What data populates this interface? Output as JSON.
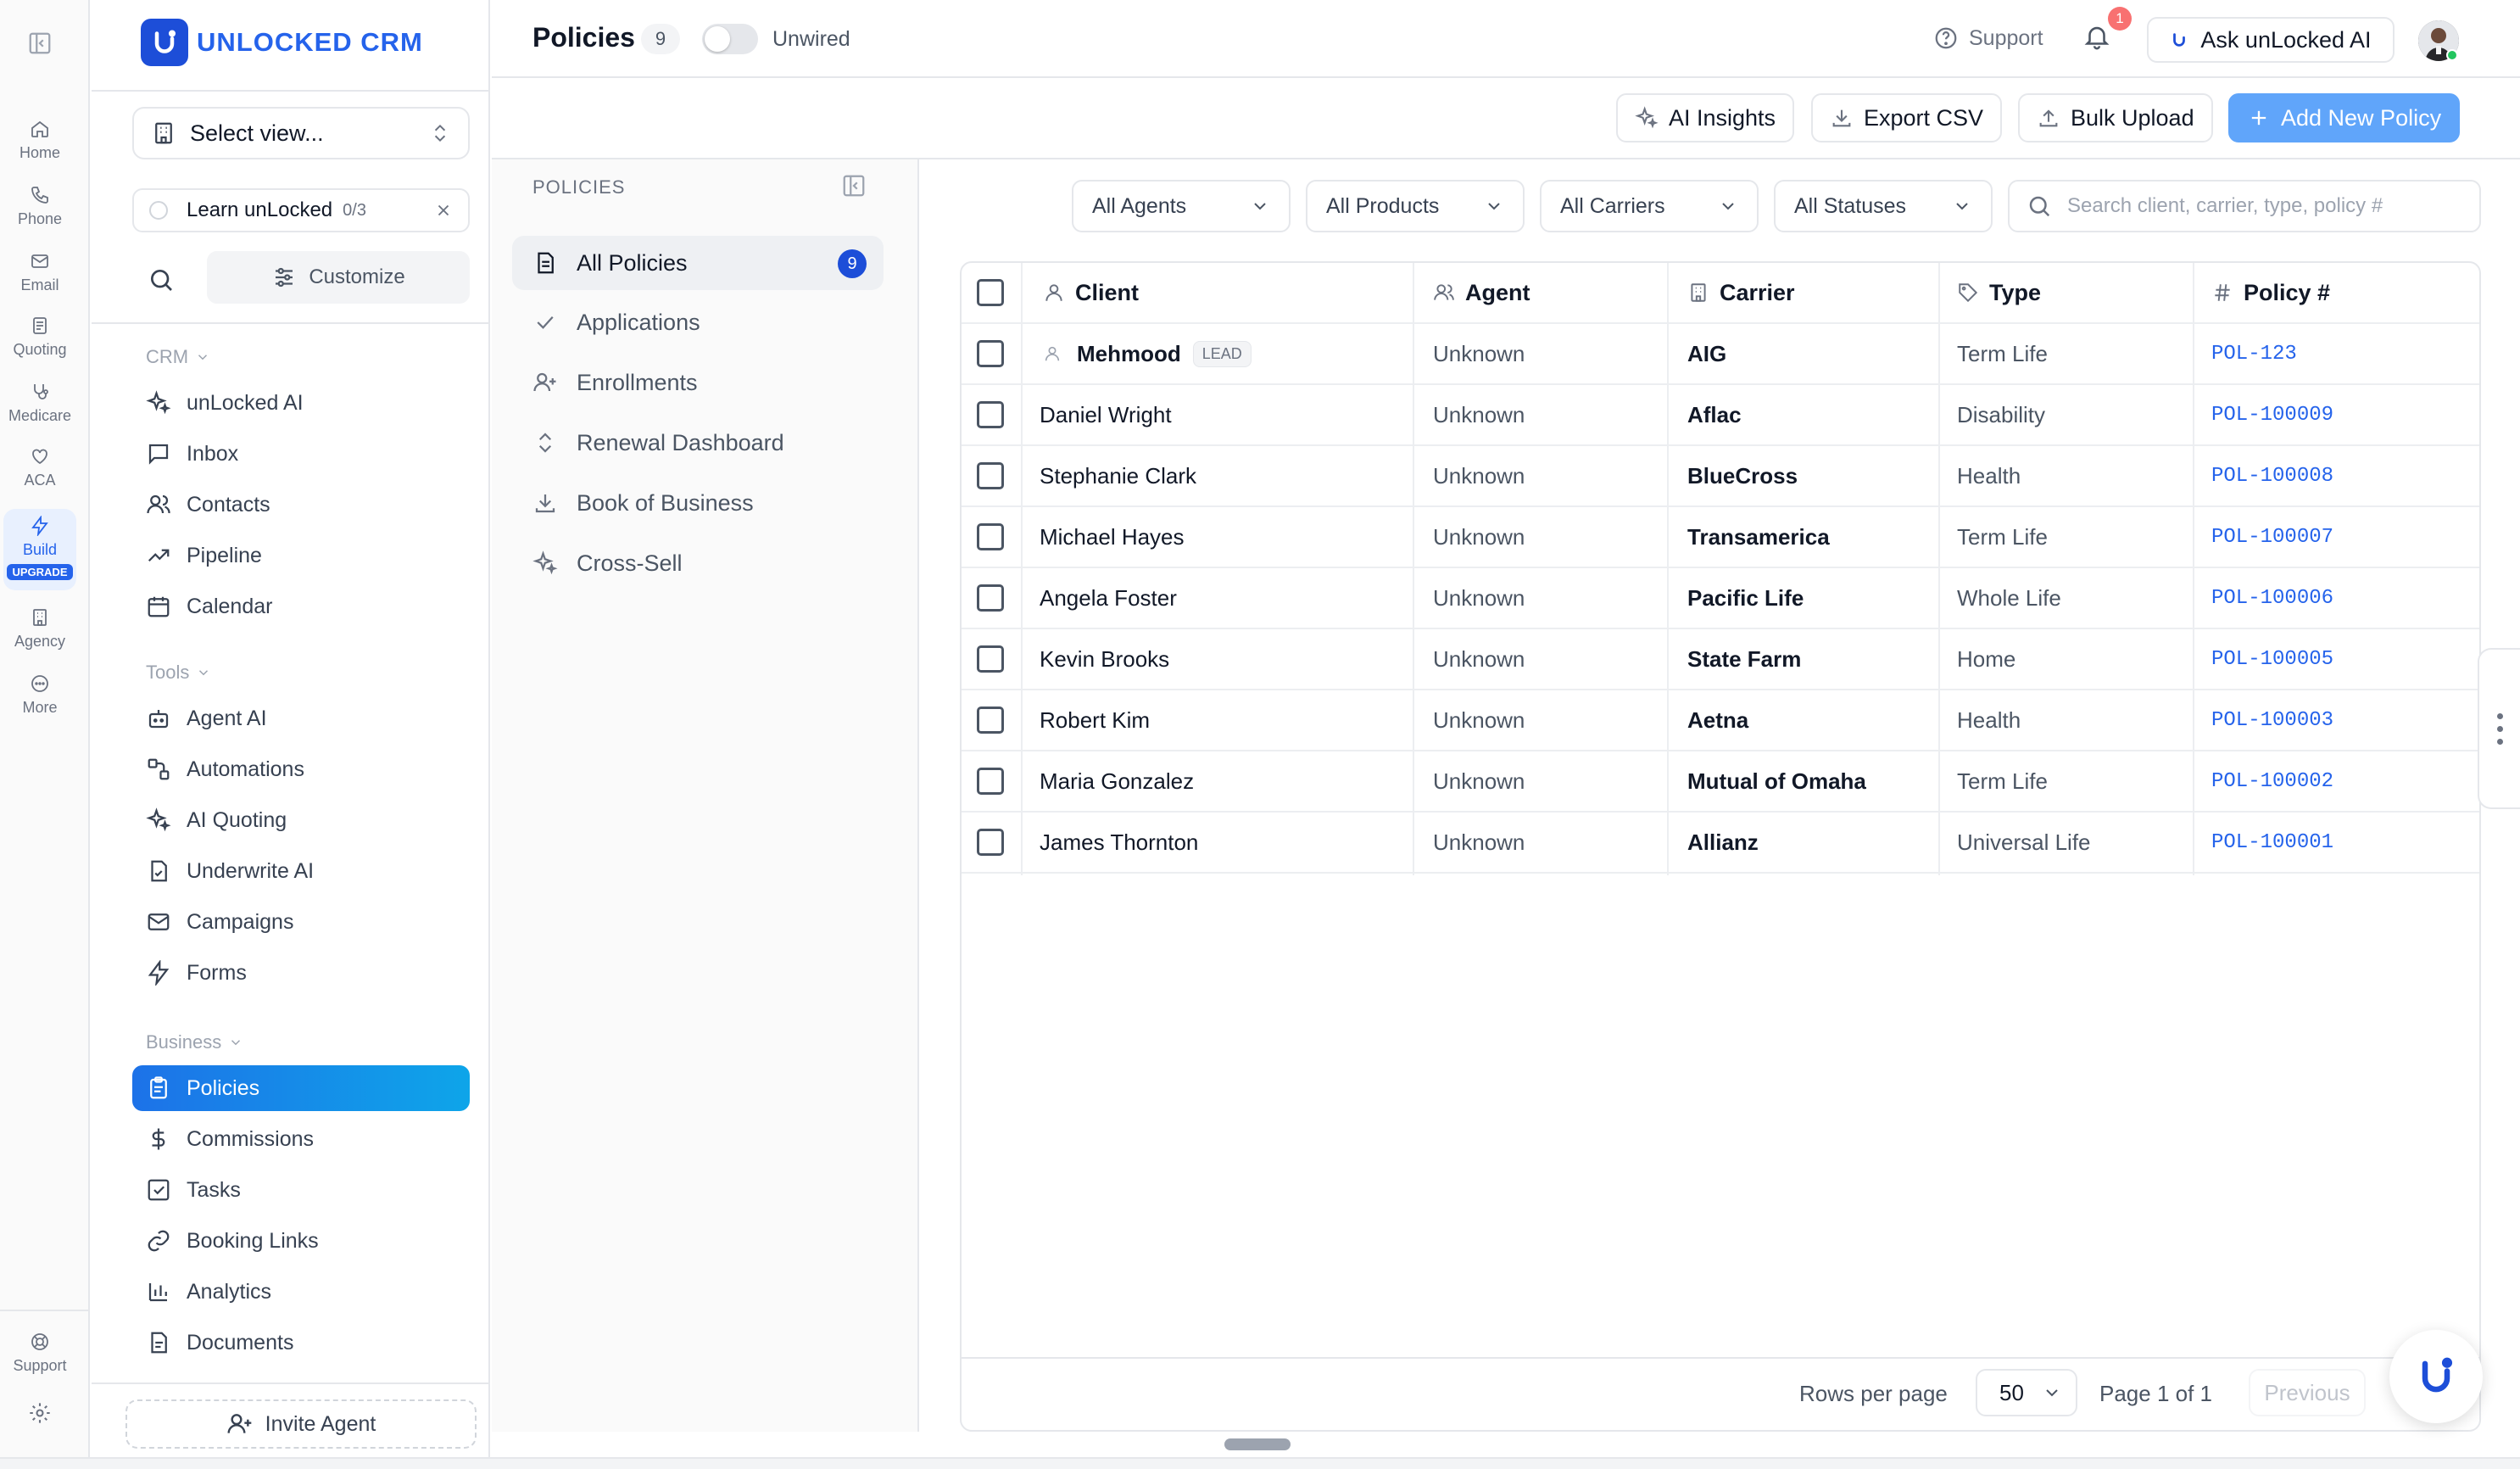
{
  "rail": {
    "items": [
      {
        "label": "Home",
        "icon": "home-icon"
      },
      {
        "label": "Phone",
        "icon": "phone-icon"
      },
      {
        "label": "Email",
        "icon": "mail-icon"
      },
      {
        "label": "Quoting",
        "icon": "document-icon"
      },
      {
        "label": "Medicare",
        "icon": "stethoscope-icon"
      },
      {
        "label": "ACA",
        "icon": "heart-icon"
      },
      {
        "label": "Build",
        "icon": "lightning-icon",
        "badge": "UPGRADE"
      },
      {
        "label": "Agency",
        "icon": "building-icon"
      },
      {
        "label": "More",
        "icon": "more-icon"
      }
    ],
    "support_label": "Support"
  },
  "sidebar": {
    "brand": "UNLOCKED CRM",
    "view_select": "Select view...",
    "learn": {
      "label": "Learn unLocked",
      "progress": "0/3"
    },
    "customize": "Customize",
    "sections": {
      "crm": "CRM",
      "tools": "Tools",
      "business": "Business"
    },
    "crm_items": [
      "unLocked AI",
      "Inbox",
      "Contacts",
      "Pipeline",
      "Calendar"
    ],
    "tools_items": [
      "Agent AI",
      "Automations",
      "AI Quoting",
      "Underwrite AI",
      "Campaigns",
      "Forms"
    ],
    "business_items": [
      "Policies",
      "Commissions",
      "Tasks",
      "Booking Links",
      "Analytics",
      "Documents"
    ],
    "invite": "Invite Agent"
  },
  "topbar": {
    "title": "Policies",
    "count": "9",
    "toggle_label": "Unwired",
    "support": "Support",
    "notifications": "1",
    "ask": "Ask unLocked AI"
  },
  "actions": {
    "ai_insights": "AI Insights",
    "export_csv": "Export CSV",
    "bulk_upload": "Bulk Upload",
    "add_new": "Add New Policy"
  },
  "subpanel": {
    "title": "POLICIES",
    "items": [
      {
        "label": "All Policies",
        "badge": "9"
      },
      {
        "label": "Applications"
      },
      {
        "label": "Enrollments"
      },
      {
        "label": "Renewal Dashboard"
      },
      {
        "label": "Book of Business"
      },
      {
        "label": "Cross-Sell"
      }
    ]
  },
  "filters": {
    "agents": "All Agents",
    "products": "All Products",
    "carriers": "All Carriers",
    "statuses": "All Statuses",
    "search_placeholder": "Search client, carrier, type, policy #"
  },
  "table": {
    "headers": {
      "client": "Client",
      "agent": "Agent",
      "carrier": "Carrier",
      "type": "Type",
      "policy": "Policy #"
    },
    "rows": [
      {
        "client": "Mehmood",
        "badge": "LEAD",
        "agent": "Unknown",
        "carrier": "AIG",
        "type": "Term Life",
        "policy": "POL-123"
      },
      {
        "client": "Daniel Wright",
        "agent": "Unknown",
        "carrier": "Aflac",
        "type": "Disability",
        "policy": "POL-100009"
      },
      {
        "client": "Stephanie Clark",
        "agent": "Unknown",
        "carrier": "BlueCross",
        "type": "Health",
        "policy": "POL-100008"
      },
      {
        "client": "Michael Hayes",
        "agent": "Unknown",
        "carrier": "Transamerica",
        "type": "Term Life",
        "policy": "POL-100007"
      },
      {
        "client": "Angela Foster",
        "agent": "Unknown",
        "carrier": "Pacific Life",
        "type": "Whole Life",
        "policy": "POL-100006"
      },
      {
        "client": "Kevin Brooks",
        "agent": "Unknown",
        "carrier": "State Farm",
        "type": "Home",
        "policy": "POL-100005"
      },
      {
        "client": "Robert Kim",
        "agent": "Unknown",
        "carrier": "Aetna",
        "type": "Health",
        "policy": "POL-100003"
      },
      {
        "client": "Maria Gonzalez",
        "agent": "Unknown",
        "carrier": "Mutual of Omaha",
        "type": "Term Life",
        "policy": "POL-100002"
      },
      {
        "client": "James Thornton",
        "agent": "Unknown",
        "carrier": "Allianz",
        "type": "Universal Life",
        "policy": "POL-100001"
      }
    ],
    "rows_per_page_label": "Rows per page",
    "rows_per_page": "50",
    "page_info": "Page 1 of 1",
    "previous": "Previous"
  },
  "colors": {
    "accent": "#1d72e8",
    "brand": "#2563eb",
    "policy_link": "#2563eb"
  }
}
